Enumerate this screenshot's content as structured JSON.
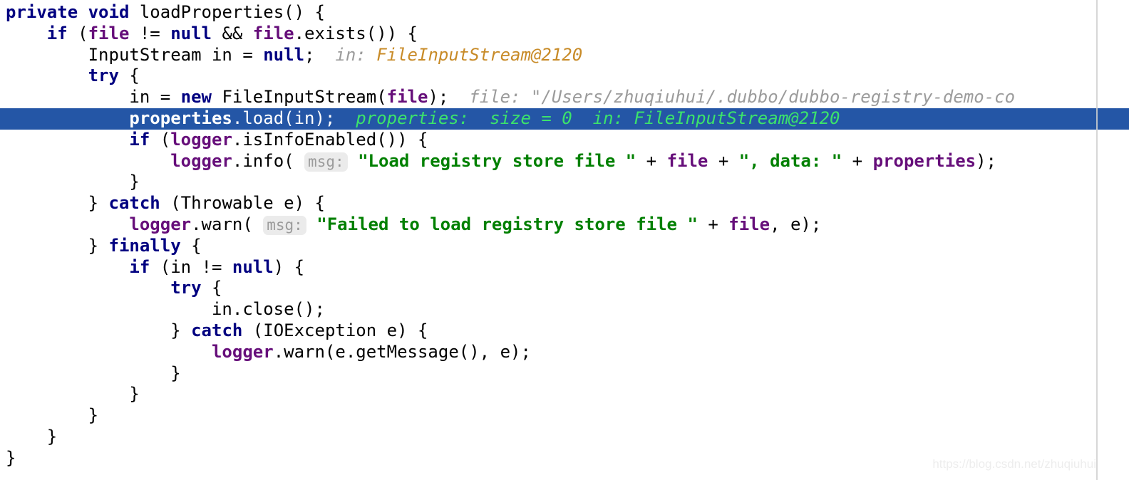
{
  "editor": {
    "language": "java",
    "selection_color": "#2456a6",
    "background_color": "#ffffff",
    "keyword_color": "#000080",
    "field_color": "#660e7a",
    "string_color": "#008000",
    "hint_gray_color": "#9b9b9b",
    "hint_orange_color": "#c88b28",
    "hint_green_color": "#3ce36b",
    "margin_guide": true,
    "selected_line_number": 6
  },
  "code": {
    "lines": [
      {
        "indent": 0,
        "tokens": [
          {
            "t": "private",
            "c": "kw"
          },
          {
            "t": " ",
            "c": "plain"
          },
          {
            "t": "void",
            "c": "kw"
          },
          {
            "t": " loadProperties() {",
            "c": "plain"
          }
        ]
      },
      {
        "indent": 1,
        "tokens": [
          {
            "t": "if",
            "c": "kw"
          },
          {
            "t": " (",
            "c": "plain"
          },
          {
            "t": "file",
            "c": "field"
          },
          {
            "t": " != ",
            "c": "plain"
          },
          {
            "t": "null",
            "c": "kw"
          },
          {
            "t": " && ",
            "c": "plain"
          },
          {
            "t": "file",
            "c": "field"
          },
          {
            "t": ".exists()) {",
            "c": "plain"
          }
        ]
      },
      {
        "indent": 2,
        "tokens": [
          {
            "t": "InputStream in = ",
            "c": "plain"
          },
          {
            "t": "null",
            "c": "kw"
          },
          {
            "t": ";  ",
            "c": "plain"
          },
          {
            "t": "in:",
            "c": "hint-gray"
          },
          {
            "t": " ",
            "c": "plain"
          },
          {
            "t": "FileInputStream@2120",
            "c": "hint-orange"
          }
        ]
      },
      {
        "indent": 2,
        "tokens": [
          {
            "t": "try",
            "c": "kw"
          },
          {
            "t": " {",
            "c": "plain"
          }
        ]
      },
      {
        "indent": 3,
        "tokens": [
          {
            "t": "in = ",
            "c": "plain"
          },
          {
            "t": "new",
            "c": "kw"
          },
          {
            "t": " FileInputStream(",
            "c": "plain"
          },
          {
            "t": "file",
            "c": "field"
          },
          {
            "t": ");  ",
            "c": "plain"
          },
          {
            "t": "file: \"/Users/zhuqiuhui/.dubbo/dubbo-registry-demo-co",
            "c": "hint-gray"
          }
        ]
      },
      {
        "indent": 3,
        "selected": true,
        "tokens": [
          {
            "t": "properties",
            "c": "sel-bold"
          },
          {
            "t": ".load(in);  ",
            "c": "sel-plain"
          },
          {
            "t": "properties:  size = 0  in: FileInputStream@2120",
            "c": "hint-green"
          }
        ]
      },
      {
        "indent": 3,
        "tokens": [
          {
            "t": "if",
            "c": "kw"
          },
          {
            "t": " (",
            "c": "plain"
          },
          {
            "t": "logger",
            "c": "field"
          },
          {
            "t": ".isInfoEnabled()) {",
            "c": "plain"
          }
        ]
      },
      {
        "indent": 4,
        "tokens": [
          {
            "t": "logger",
            "c": "field"
          },
          {
            "t": ".info( ",
            "c": "plain"
          },
          {
            "t": "msg:",
            "c": "param-chip"
          },
          {
            "t": " ",
            "c": "plain"
          },
          {
            "t": "\"Load registry store file \"",
            "c": "str"
          },
          {
            "t": " + ",
            "c": "plain"
          },
          {
            "t": "file",
            "c": "field"
          },
          {
            "t": " + ",
            "c": "plain"
          },
          {
            "t": "\", data: \"",
            "c": "str"
          },
          {
            "t": " + ",
            "c": "plain"
          },
          {
            "t": "properties",
            "c": "field"
          },
          {
            "t": ");",
            "c": "plain"
          }
        ]
      },
      {
        "indent": 3,
        "tokens": [
          {
            "t": "}",
            "c": "plain"
          }
        ]
      },
      {
        "indent": 2,
        "tokens": [
          {
            "t": "} ",
            "c": "plain"
          },
          {
            "t": "catch",
            "c": "kw"
          },
          {
            "t": " (Throwable e) {",
            "c": "plain"
          }
        ]
      },
      {
        "indent": 3,
        "tokens": [
          {
            "t": "logger",
            "c": "field"
          },
          {
            "t": ".warn( ",
            "c": "plain"
          },
          {
            "t": "msg:",
            "c": "param-chip"
          },
          {
            "t": " ",
            "c": "plain"
          },
          {
            "t": "\"Failed to load registry store file \"",
            "c": "str"
          },
          {
            "t": " + ",
            "c": "plain"
          },
          {
            "t": "file",
            "c": "field"
          },
          {
            "t": ", e);",
            "c": "plain"
          }
        ]
      },
      {
        "indent": 2,
        "tokens": [
          {
            "t": "} ",
            "c": "plain"
          },
          {
            "t": "finally",
            "c": "kw"
          },
          {
            "t": " {",
            "c": "plain"
          }
        ]
      },
      {
        "indent": 3,
        "tokens": [
          {
            "t": "if",
            "c": "kw"
          },
          {
            "t": " (in != ",
            "c": "plain"
          },
          {
            "t": "null",
            "c": "kw"
          },
          {
            "t": ") {",
            "c": "plain"
          }
        ]
      },
      {
        "indent": 4,
        "tokens": [
          {
            "t": "try",
            "c": "kw"
          },
          {
            "t": " {",
            "c": "plain"
          }
        ]
      },
      {
        "indent": 5,
        "tokens": [
          {
            "t": "in.close();",
            "c": "plain"
          }
        ]
      },
      {
        "indent": 4,
        "tokens": [
          {
            "t": "} ",
            "c": "plain"
          },
          {
            "t": "catch",
            "c": "kw"
          },
          {
            "t": " (IOException e) {",
            "c": "plain"
          }
        ]
      },
      {
        "indent": 5,
        "tokens": [
          {
            "t": "logger",
            "c": "field"
          },
          {
            "t": ".warn(e.getMessage(), e);",
            "c": "plain"
          }
        ]
      },
      {
        "indent": 4,
        "tokens": [
          {
            "t": "}",
            "c": "plain"
          }
        ]
      },
      {
        "indent": 3,
        "tokens": [
          {
            "t": "}",
            "c": "plain"
          }
        ]
      },
      {
        "indent": 2,
        "tokens": [
          {
            "t": "}",
            "c": "plain"
          }
        ]
      },
      {
        "indent": 1,
        "tokens": [
          {
            "t": "}",
            "c": "plain"
          }
        ]
      },
      {
        "indent": 0,
        "tokens": [
          {
            "t": "}",
            "c": "plain"
          }
        ]
      }
    ]
  },
  "watermark": {
    "text": "https://blog.csdn.net/zhuqiuhui"
  }
}
